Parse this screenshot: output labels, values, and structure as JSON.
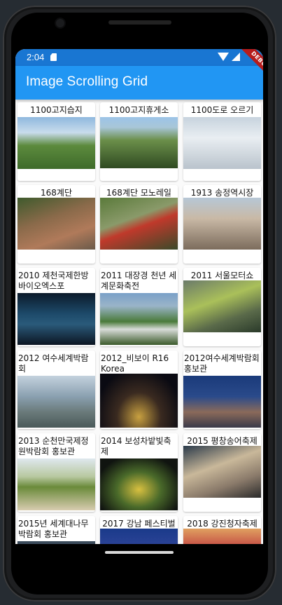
{
  "statusbar": {
    "time": "2:04"
  },
  "appbar": {
    "title": "Image Scrolling Grid",
    "debug_label": "DEBUG"
  },
  "colors": {
    "appbar": "#2196f3",
    "statusbar": "#1976d2",
    "debug_banner": "#b71c1c"
  },
  "grid": {
    "items": [
      {
        "title": "1100고지습지",
        "icon": "photo-icon"
      },
      {
        "title": "1100고지휴게소",
        "icon": "photo-icon"
      },
      {
        "title": "1100도로 오르기",
        "icon": "photo-icon"
      },
      {
        "title": "168계단",
        "icon": "photo-icon"
      },
      {
        "title": "168계단 모노레일",
        "icon": "photo-icon"
      },
      {
        "title": "1913 송정역시장",
        "icon": "photo-icon"
      },
      {
        "title": "2010 제천국제한방바이오엑스포",
        "icon": "photo-icon"
      },
      {
        "title": "2011 대장경 천년 세계문화축전",
        "icon": "photo-icon"
      },
      {
        "title": "2011 서울모터쇼",
        "icon": "photo-icon"
      },
      {
        "title": "2012 여수세계박람회",
        "icon": "photo-icon"
      },
      {
        "title": "2012_비보이 R16 Korea",
        "icon": "photo-icon"
      },
      {
        "title": "2012여수세계박람회 홍보관",
        "icon": "photo-icon"
      },
      {
        "title": "2013 순천만국제정원박람회 홍보관",
        "icon": "photo-icon"
      },
      {
        "title": "2014 보성차밭빛축제",
        "icon": "photo-icon"
      },
      {
        "title": "2015 평창송어축제",
        "icon": "photo-icon"
      },
      {
        "title": "2015년 세계대나무박람회 홍보관",
        "icon": "photo-icon"
      },
      {
        "title": "2017 강남 페스티벌",
        "icon": "photo-icon"
      },
      {
        "title": "2018 강진청자축제",
        "icon": "photo-icon"
      }
    ]
  }
}
